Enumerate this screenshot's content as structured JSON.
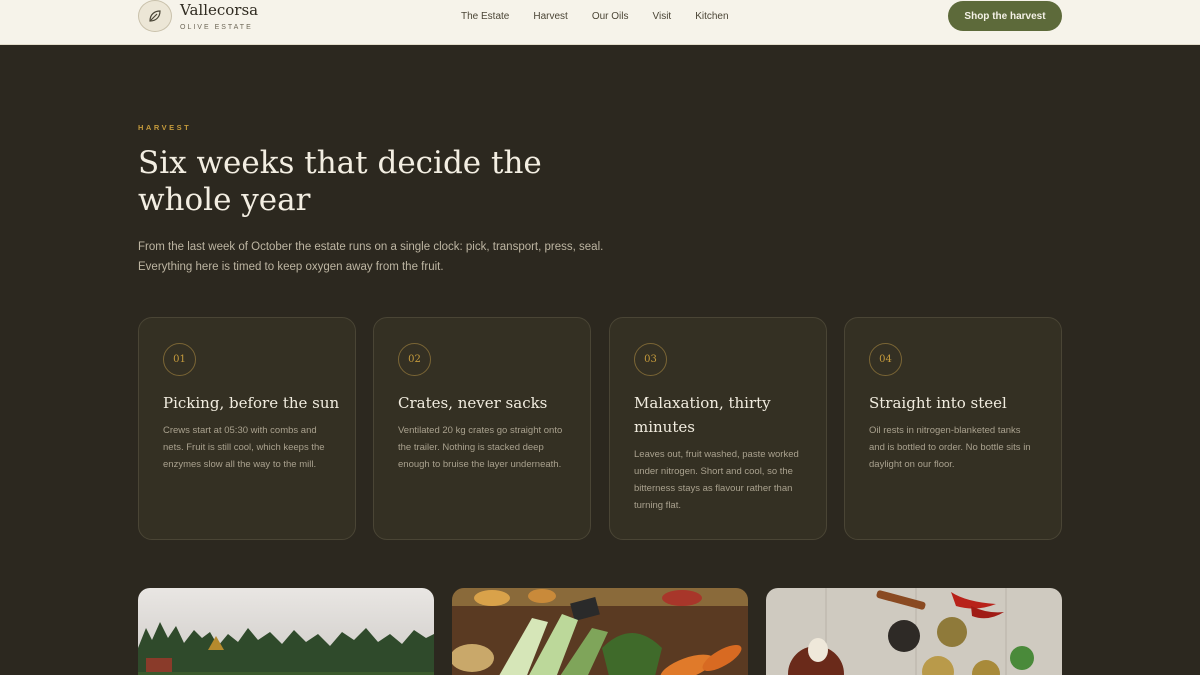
{
  "header": {
    "brand_name": "Vallecorsa",
    "brand_tagline": "OLIVE ESTATE",
    "logo_icon": "leaf-icon",
    "nav": [
      "The Estate",
      "Harvest",
      "Our Oils",
      "Visit",
      "Kitchen"
    ],
    "cta_label": "Shop the harvest"
  },
  "hero": {
    "eyebrow": "HARVEST",
    "title": "Six weeks that decide the whole year",
    "intro": "From the last week of October the estate runs on a single clock: pick, transport, press, seal. Everything here is timed to keep oxygen away from the fruit."
  },
  "steps": [
    {
      "num": "01",
      "title": "Picking, before the sun",
      "text": "Crews start at 05:30 with combs and nets. Fruit is still cool, which keeps the enzymes slow all the way to the mill."
    },
    {
      "num": "02",
      "title": "Crates, never sacks",
      "text": "Ventilated 20 kg crates go straight onto the trailer. Nothing is stacked deep enough to bruise the layer underneath."
    },
    {
      "num": "03",
      "title": "Malaxation, thirty minutes",
      "text": "Leaves out, fruit washed, paste worked under nitrogen. Short and cool, so the bitterness stays as flavour rather than turning flat."
    },
    {
      "num": "04",
      "title": "Straight into steel",
      "text": "Oil rests in nitrogen-blanketed tanks and is bottled to order. No bottle sits in daylight on our floor."
    }
  ],
  "colors": {
    "background": "#2c281f",
    "header_bg": "#f6f3ea",
    "accent_gold": "#c49a3c",
    "cta_green": "#5d6a3a",
    "card_bg": "#343023"
  }
}
